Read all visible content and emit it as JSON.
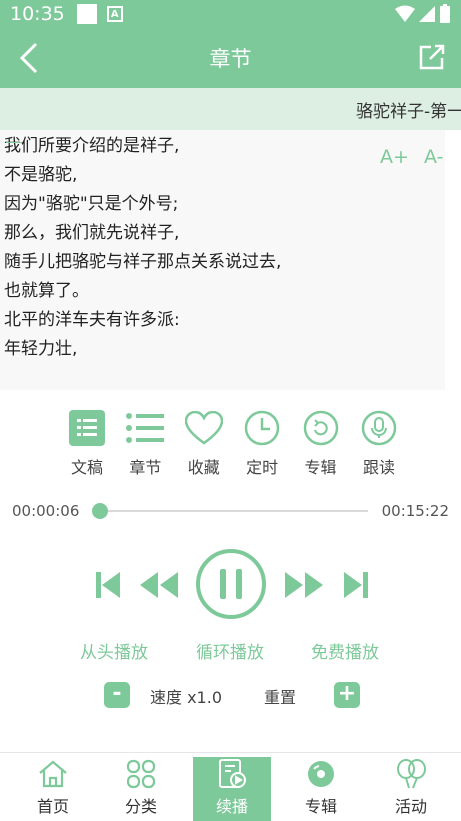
{
  "status_bar": {
    "time": "10:35",
    "notif_letter": "A"
  },
  "header": {
    "title": "章节"
  },
  "marquee": {
    "text": "骆驼祥子-第一"
  },
  "reader": {
    "dash": "—",
    "font_up": "A+",
    "font_down": "A-",
    "lines": [
      "我们所要介绍的是祥子,",
      "不是骆驼,",
      "因为\"骆驼\"只是个外号;",
      "那么，我们就先说祥子,",
      "随手儿把骆驼与祥子那点关系说过去,",
      "也就算了。",
      "北平的洋车夫有许多派:",
      "年轻力壮,"
    ]
  },
  "tools": [
    {
      "label": "文稿",
      "icon": "document-list-icon"
    },
    {
      "label": "章节",
      "icon": "chapter-list-icon"
    },
    {
      "label": "收藏",
      "icon": "heart-icon"
    },
    {
      "label": "定时",
      "icon": "clock-icon"
    },
    {
      "label": "专辑",
      "icon": "album-refresh-icon"
    },
    {
      "label": "跟读",
      "icon": "microphone-icon"
    }
  ],
  "player": {
    "current_time": "00:00:06",
    "total_time": "00:15:22",
    "progress_fraction": 0.0065
  },
  "modes": {
    "from_start": "从头播放",
    "loop": "循环播放",
    "free": "免费播放"
  },
  "speed": {
    "label": "速度 x1.0",
    "reset": "重置",
    "minus": "-",
    "plus": "+"
  },
  "tabbar": [
    {
      "label": "首页",
      "icon": "home-icon",
      "active": false
    },
    {
      "label": "分类",
      "icon": "category-icon",
      "active": false
    },
    {
      "label": "续播",
      "icon": "continue-play-icon",
      "active": true
    },
    {
      "label": "专辑",
      "icon": "album-disc-icon",
      "active": false
    },
    {
      "label": "活动",
      "icon": "balloon-icon",
      "active": false
    }
  ],
  "colors": {
    "accent": "#7ec99a",
    "marquee_bg": "#dcefe2"
  }
}
